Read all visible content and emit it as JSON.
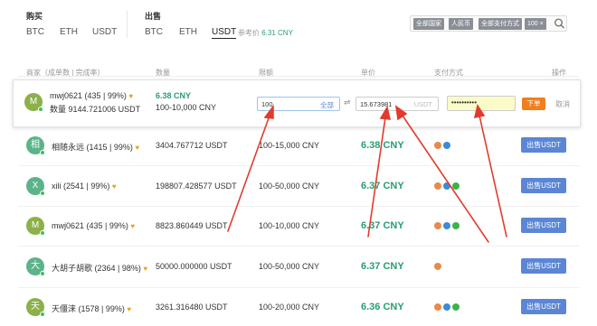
{
  "nav": {
    "buy_title": "购买",
    "buy_links": [
      "BTC",
      "ETH",
      "USDT"
    ],
    "sell_title": "出售",
    "sell_links": [
      "BTC",
      "ETH"
    ],
    "sell_active": "USDT",
    "ref_price_label": "参考价",
    "ref_price_value": "6.31 CNY"
  },
  "filters": {
    "chips": [
      "全部国家",
      "人民币",
      "全部支付方式",
      "100"
    ],
    "chip_close": "×"
  },
  "table_headers": {
    "merchant": "商家（成单数 | 完成率）",
    "quantity": "数量",
    "limit": "限额",
    "unit_price": "单价",
    "payment": "支付方式",
    "action": "操作"
  },
  "expanded_order": {
    "avatar": "M",
    "merchant": "mwj0621 (435 | 99%)",
    "quantity_label": "数量",
    "quantity_value": "9144.721006 USDT",
    "price": "6.38 CNY",
    "limit": "100-10,000 CNY",
    "amount_input": "100",
    "all_label": "全部",
    "swap_icon": "⇌",
    "usdt_input": "15.673981",
    "usdt_unit": "USDT",
    "password_value": "••••••••••",
    "confirm_label": "下单",
    "cancel_label": "取消"
  },
  "rows": [
    {
      "avatar": "相",
      "color": "#5bb38a",
      "merchant": "相随永远 (1415 | 99%)",
      "quantity": "3404.767712 USDT",
      "limit": "100-15,000 CNY",
      "price": "6.38 CNY",
      "action": "出售USDT"
    },
    {
      "avatar": "X",
      "color": "#5bb38a",
      "merchant": "xili (2541 | 99%)",
      "quantity": "198807.428577 USDT",
      "limit": "100-50,000 CNY",
      "price": "6.37 CNY",
      "action": "出售USDT"
    },
    {
      "avatar": "M",
      "color": "#8cb04a",
      "merchant": "mwj0621 (435 | 99%)",
      "quantity": "8823.860449 USDT",
      "limit": "100-10,000 CNY",
      "price": "6.37 CNY",
      "action": "出售USDT"
    },
    {
      "avatar": "大",
      "color": "#5bb38a",
      "merchant": "大胡子胡歌 (2364 | 98%)",
      "quantity": "50000.000000 USDT",
      "limit": "100-50,000 CNY",
      "price": "6.37 CNY",
      "action": "出售USDT"
    },
    {
      "avatar": "天",
      "color": "#8cb04a",
      "merchant": "天僵涞 (1578 | 99%)",
      "quantity": "3261.316480 USDT",
      "limit": "100-20,000 CNY",
      "price": "6.36 CNY",
      "action": "出售USDT"
    }
  ],
  "colors": {
    "price_green": "#2a9d6f",
    "sell_button": "#5b86d6",
    "confirm_button": "#ef7f1f",
    "annotation_arrow": "#e23b2e"
  }
}
